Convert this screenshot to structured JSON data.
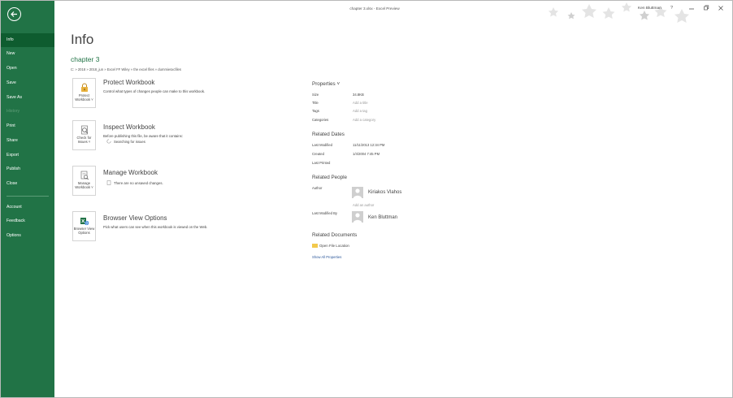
{
  "window": {
    "title": "chapter 3.xlsx  -  Excel Preview",
    "user": "Ken Bluttman",
    "help_label": "?"
  },
  "sidebar": {
    "items": [
      {
        "label": "Info"
      },
      {
        "label": "New"
      },
      {
        "label": "Open"
      },
      {
        "label": "Save"
      },
      {
        "label": "Save As"
      },
      {
        "label": "History"
      },
      {
        "label": "Print"
      },
      {
        "label": "Share"
      },
      {
        "label": "Export"
      },
      {
        "label": "Publish"
      },
      {
        "label": "Close"
      },
      {
        "label": "Account"
      },
      {
        "label": "Feedback"
      },
      {
        "label": "Options"
      }
    ]
  },
  "page": {
    "title": "Info",
    "doc_name": "chapter 3",
    "doc_path": "C: » 2018 » 2018_jun » Excel FF Wiley » the excel files » dummiesxcfiles"
  },
  "actions": [
    {
      "button_label": "Protect\nWorkbook ˅",
      "heading": "Protect Workbook",
      "desc": "Control what types of changes people can make to this workbook.",
      "sub": ""
    },
    {
      "button_label": "Check for\nIssues ˅",
      "heading": "Inspect Workbook",
      "desc": "Before publishing this file, be aware that it contains:",
      "sub": "Searching for issues"
    },
    {
      "button_label": "Manage\nWorkbook ˅",
      "heading": "Manage Workbook",
      "desc": "",
      "sub": "There are no unsaved changes."
    },
    {
      "button_label": "Browser View\nOptions",
      "heading": "Browser View Options",
      "desc": "Pick what users can see when this workbook is viewed on the Web.",
      "sub": ""
    }
  ],
  "properties": {
    "heading": "Properties ˅",
    "rows": [
      {
        "key": "Size",
        "value": "34.8KB"
      },
      {
        "key": "Title",
        "value": "Add a title"
      },
      {
        "key": "Tags",
        "value": "Add a tag"
      },
      {
        "key": "Categories",
        "value": "Add a category"
      }
    ]
  },
  "related_dates": {
    "heading": "Related Dates",
    "rows": [
      {
        "key": "Last Modified",
        "value": "11/11/2013 12:34 PM"
      },
      {
        "key": "Created",
        "value": "1/4/2004 7:45 PM"
      },
      {
        "key": "Last Printed",
        "value": ""
      }
    ]
  },
  "related_people": {
    "heading": "Related People",
    "author_label": "Author",
    "author": "Kiriakos Vlahos",
    "add_author": "Add an author",
    "last_modified_by_label": "Last Modified By",
    "last_modified_by": "Ken Bluttman"
  },
  "related_documents": {
    "heading": "Related Documents",
    "open_location": "Open File Location",
    "show_all": "Show All Properties"
  },
  "colors": {
    "sidebar": "#217346",
    "sidebar_active": "#0e5c2f",
    "accent_link": "#2b579a"
  }
}
